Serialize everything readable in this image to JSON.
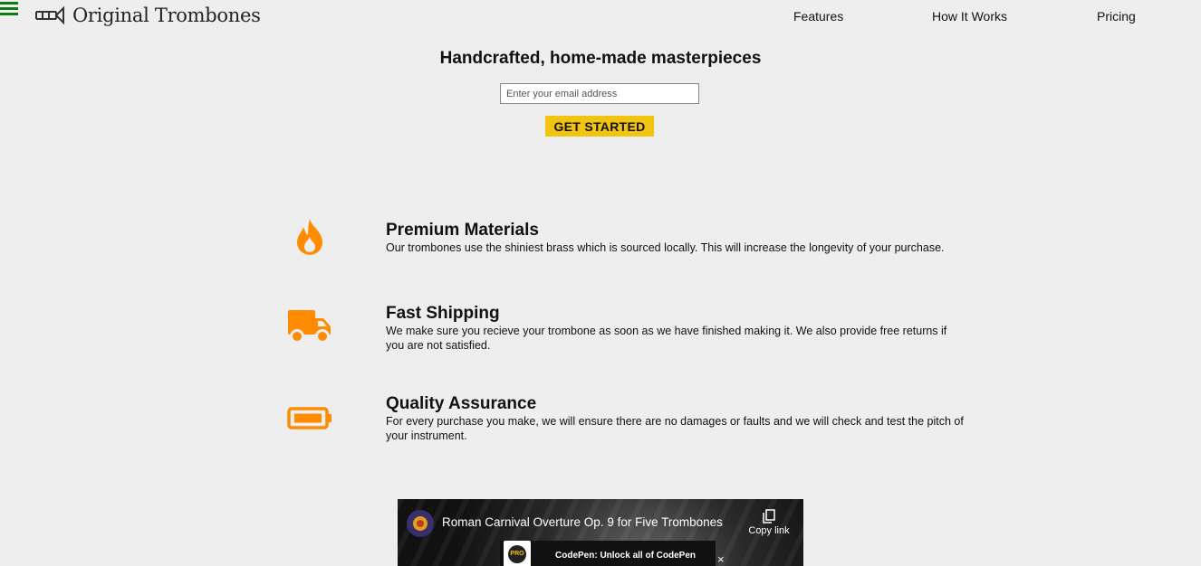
{
  "header": {
    "logo_text": "Original Trombones",
    "nav": [
      "Features",
      "How It Works",
      "Pricing"
    ]
  },
  "hero": {
    "title": "Handcrafted, home-made masterpieces",
    "email_placeholder": "Enter your email address",
    "cta_label": "GET STARTED"
  },
  "features": [
    {
      "icon": "fire-icon",
      "title": "Premium Materials",
      "description": "Our trombones use the shiniest brass which is sourced locally. This will increase the longevity of your purchase."
    },
    {
      "icon": "truck-icon",
      "title": "Fast Shipping",
      "description": "We make sure you recieve your trombone as soon as we have finished making it. We also provide free returns if you are not satisfied."
    },
    {
      "icon": "battery-icon",
      "title": "Quality Assurance",
      "description": "For every purchase you make, we will ensure there are no damages or faults and we will check and test the pitch of your instrument."
    }
  ],
  "video": {
    "title": "Roman Carnival Overture Op. 9 for Five Trombones",
    "copy_link_label": "Copy link",
    "banner_text": "CodePen: Unlock all of CodePen",
    "pro_label": "PRO",
    "close_symbol": "×"
  },
  "colors": {
    "accent": "#f1c40f",
    "icon": "#ff8c00",
    "menu": "#0d7a13",
    "background": "#eeeeee"
  }
}
